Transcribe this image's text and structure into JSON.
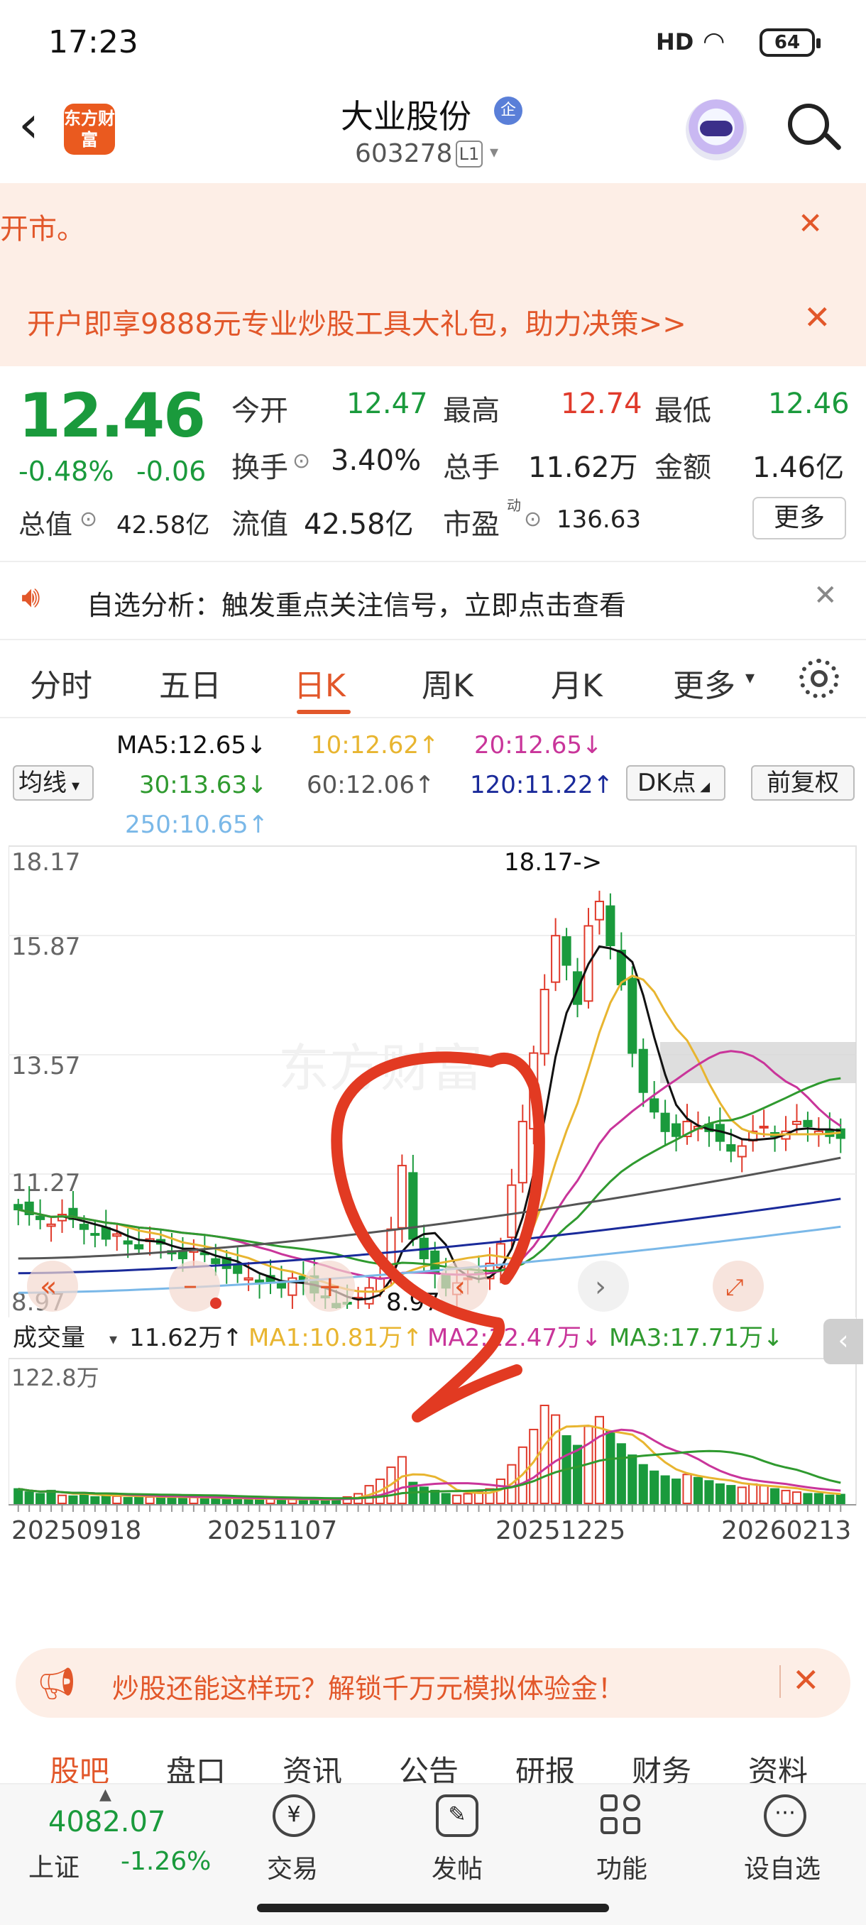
{
  "status": {
    "time": "17:23",
    "signal": "HD",
    "battery": "64"
  },
  "header": {
    "back": "‹",
    "brand": "东方财富",
    "name": "大业股份",
    "corp_badge": "企",
    "code": "603278",
    "level": "L1",
    "caret": "▾"
  },
  "notice": {
    "text": "开市。",
    "close": "✕"
  },
  "promo": {
    "text": "开户即享9888元专业炒股工具大礼包，助力决策>>",
    "close": "✕"
  },
  "quote": {
    "price": "12.46",
    "change_pct": "-0.48%",
    "change": "-0.06",
    "open_label": "今开",
    "open": "12.47",
    "high_label": "最高",
    "high": "12.74",
    "low_label": "最低",
    "low": "12.46",
    "turnover_label": "换手",
    "turnover": "3.40%",
    "volume_label": "总手",
    "volume": "11.62万",
    "amount_label": "金额",
    "amount": "1.46亿",
    "mktcap_label": "总值",
    "mktcap": "42.58亿",
    "float_label": "流值",
    "float": "42.58亿",
    "pe_label": "市盈",
    "pe_sup": "动",
    "pe": "136.63",
    "more": "更多"
  },
  "analysis": {
    "text": "自选分析：触发重点关注信号，立即点击查看",
    "close": "✕"
  },
  "tabs": [
    "分时",
    "五日",
    "日K",
    "周K",
    "月K",
    "更多"
  ],
  "tab_more_caret": "▾",
  "ma_legend": {
    "select": "均线",
    "ma5": "MA5:12.65↓",
    "ma10": "10:12.62↑",
    "ma20": "20:12.65↓",
    "ma30": "30:13.63↓",
    "ma60": "60:12.06↑",
    "ma120": "120:11.22↑",
    "ma250": "250:10.65↑",
    "dk": "DK点",
    "adjust": "前复权"
  },
  "colors": {
    "up": "#e03a2b",
    "down": "#1a9a3c",
    "ma5": "#111111",
    "ma10": "#e8b530",
    "ma20": "#c9359a",
    "ma30": "#2f9a2f",
    "ma60": "#555555",
    "ma120": "#1a2a9a",
    "ma250": "#7ab8e8",
    "accent": "#e2572a"
  },
  "chart_data": {
    "type": "candlestick",
    "y_ticks": [
      "18.17",
      "15.87",
      "13.57",
      "11.27",
      "8.97"
    ],
    "ylim": [
      8.97,
      18.17
    ],
    "high_annotation": "18.17->",
    "low_annotation": "8.97",
    "close": [
      11.0,
      10.9,
      10.8,
      10.7,
      10.9,
      10.8,
      10.6,
      10.5,
      10.4,
      10.5,
      10.3,
      10.2,
      10.4,
      10.3,
      10.1,
      10.0,
      10.2,
      10.1,
      9.9,
      9.8,
      9.7,
      9.6,
      9.5,
      9.5,
      9.4,
      9.6,
      9.5,
      9.3,
      9.2,
      9.0,
      9.1,
      9.2,
      9.4,
      9.6,
      10.6,
      11.9,
      10.4,
      10.0,
      9.7,
      9.4,
      9.5,
      9.6,
      9.7,
      9.9,
      10.3,
      11.5,
      12.8,
      14.2,
      15.5,
      16.6,
      16.0,
      15.2,
      16.8,
      17.3,
      16.4,
      15.6,
      14.2,
      13.4,
      13.0,
      12.6,
      12.5,
      12.8,
      12.7,
      12.6,
      12.4,
      12.2,
      12.3,
      12.6,
      12.7,
      12.5,
      12.6,
      12.8,
      12.7,
      12.6,
      12.5,
      12.46
    ],
    "volume_label": "成交量",
    "volume_current": "11.62万↑",
    "vol_ma1": "MA1:10.81万↑",
    "vol_ma2": "MA2:12.47万↓",
    "vol_ma3": "MA3:17.71万↓",
    "vol_max_label": "122.8万",
    "volumes": [
      18,
      14,
      12,
      16,
      10,
      9,
      13,
      8,
      11,
      9,
      7,
      10,
      8,
      7,
      9,
      6,
      8,
      7,
      6,
      5,
      7,
      6,
      5,
      6,
      4,
      5,
      6,
      5,
      4,
      6,
      8,
      12,
      22,
      30,
      45,
      58,
      26,
      20,
      16,
      12,
      10,
      12,
      14,
      18,
      30,
      48,
      70,
      92,
      122,
      110,
      84,
      72,
      96,
      108,
      90,
      74,
      60,
      48,
      40,
      34,
      30,
      36,
      32,
      28,
      24,
      22,
      20,
      24,
      22,
      18,
      16,
      14,
      12,
      12,
      10,
      11
    ],
    "x_labels": [
      "20250918",
      "20251107",
      "20251225",
      "20260213"
    ]
  },
  "ad": {
    "text": "炒股还能这样玩？解锁千万元模拟体验金！",
    "close": "✕"
  },
  "subtabs": [
    "股吧",
    "盘口",
    "资讯",
    "公告",
    "研报",
    "财务",
    "资料"
  ],
  "bottom_nav": {
    "index_value": "4082.07",
    "index_name": "上证",
    "index_change": "-1.26%",
    "items": [
      "交易",
      "发帖",
      "功能",
      "设自选"
    ]
  }
}
